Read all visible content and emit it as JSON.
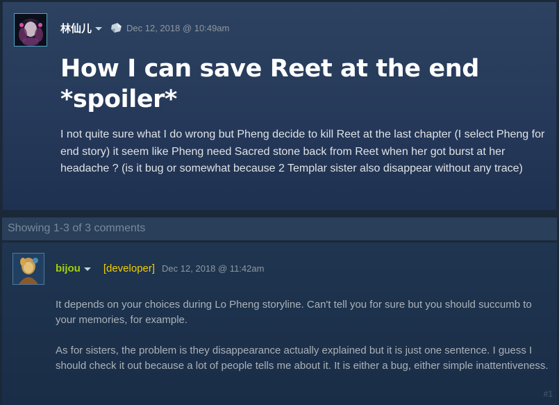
{
  "post": {
    "author": "林仙儿",
    "timestamp": "Dec 12, 2018 @ 10:49am",
    "title": "How I can save Reet at the end *spoiler*",
    "body": "I not quite sure what I do wrong but Pheng decide to kill Reet at the last chapter (I select Pheng for end story) it seem like Pheng need Sacred stone back from Reet when her got burst at her headache ? (is it bug or somewhat because 2 Templar sister also disappear without any trace)",
    "icons": {
      "menu": "chevron-down-icon",
      "badge": "stone-icon"
    }
  },
  "comments_header": {
    "count_text": "Showing 1-3 of 3 comments"
  },
  "comments": [
    {
      "author": "bijou",
      "tag": "[developer]",
      "timestamp": "Dec 12, 2018 @ 11:42am",
      "paragraphs": [
        "It depends on your choices during Lo Pheng storyline. Can't tell you for sure but you should succumb to your memories, for example.",
        "As for sisters, the problem is they disappearance actually explained but it is just one sentence. I guess I should check it out because a lot of people tells me about it. It is either a bug, either simple inattentiveness."
      ],
      "index": "#1"
    }
  ],
  "colors": {
    "background": "#1b2838",
    "author_developer": "#a4d007",
    "developer_tag": "#f3ce00",
    "timestamp": "#8f98a0"
  }
}
